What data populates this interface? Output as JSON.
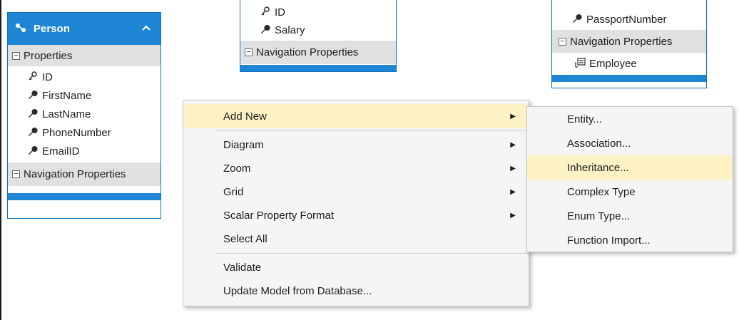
{
  "entities": {
    "person": {
      "title": "Person",
      "sections": {
        "properties": "Properties",
        "nav": "Navigation Properties"
      },
      "properties": [
        "ID",
        "FirstName",
        "LastName",
        "PhoneNumber",
        "EmailID"
      ]
    },
    "middle": {
      "properties": [
        "ID",
        "Salary"
      ],
      "nav": "Navigation Properties"
    },
    "right": {
      "properties": [
        "PassportNumber"
      ],
      "nav": "Navigation Properties",
      "nav_items": [
        "Employee"
      ]
    }
  },
  "context_menu": {
    "items": [
      {
        "label": "Add New"
      },
      {
        "label": "Diagram"
      },
      {
        "label": "Zoom"
      },
      {
        "label": "Grid"
      },
      {
        "label": "Scalar Property Format"
      },
      {
        "label": "Select All"
      },
      {
        "label": "Validate"
      },
      {
        "label": "Update Model from Database..."
      }
    ]
  },
  "submenu": {
    "items": [
      {
        "label": "Entity..."
      },
      {
        "label": "Association..."
      },
      {
        "label": "Inheritance..."
      },
      {
        "label": "Complex Type"
      },
      {
        "label": "Enum Type..."
      },
      {
        "label": "Function Import..."
      }
    ]
  },
  "colors": {
    "entity_header": "#1f86d6",
    "menu_highlight": "#fcf2c4",
    "section_bg": "#e0e0e0"
  },
  "icons": {
    "key": "key-icon",
    "property": "wrench-icon",
    "navigation": "navigation-property-icon",
    "entity": "entity-icon",
    "collapse": "chevron-up-icon",
    "submenu": "triangle-right-icon"
  }
}
